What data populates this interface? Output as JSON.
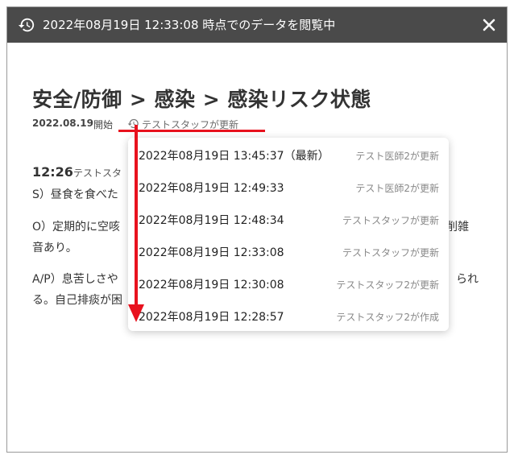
{
  "header": {
    "title": "2022年08月19日 12:33:08 時点でのデータを閲覧中",
    "history_icon": "history-icon",
    "close_icon": "close-icon",
    "background_color": "#4a4a4a"
  },
  "page": {
    "title": "安全/防御 > 感染 > 感染リスク状態",
    "date": "2022.08.19",
    "start_label": "開始",
    "history_link": "テストスタッフが更新"
  },
  "entry": {
    "time": "12:26",
    "staff": "テストスタ",
    "lines": [
      "S）昼食を食べた",
      "O）定期的に空咳",
      "削雑",
      "音あり。",
      "A/P）息苦しさや",
      "られ",
      "る。自己排痰が困"
    ]
  },
  "history_dropdown": {
    "items": [
      {
        "time": "2022年08月19日 13:45:37（最新）",
        "who": "テスト医師2が更新"
      },
      {
        "time": "2022年08月19日 12:49:33",
        "who": "テスト医師2が更新"
      },
      {
        "time": "2022年08月19日 12:48:34",
        "who": "テストスタッフが更新"
      },
      {
        "time": "2022年08月19日 12:33:08",
        "who": "テストスタッフが更新"
      },
      {
        "time": "2022年08月19日 12:30:08",
        "who": "テストスタッフ2が更新"
      },
      {
        "time": "2022年08月19日 12:28:57",
        "who": "テストスタッフ2が作成"
      }
    ]
  },
  "annotation": {
    "color": "#e8121e"
  }
}
